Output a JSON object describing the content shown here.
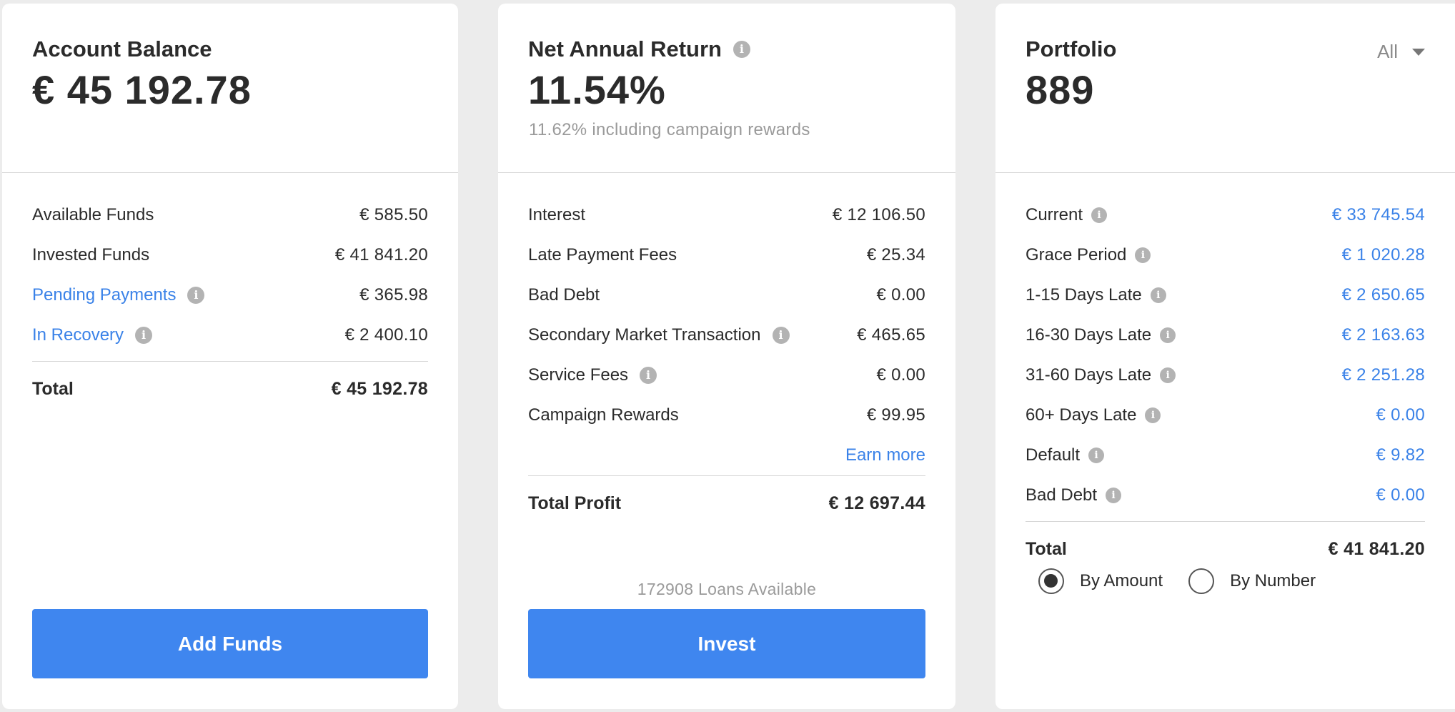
{
  "account_balance": {
    "title": "Account Balance",
    "amount": "€ 45 192.78",
    "rows": [
      {
        "label": "Available Funds",
        "value": "€ 585.50"
      },
      {
        "label": "Invested Funds",
        "value": "€ 41 841.20"
      },
      {
        "label": "Pending Payments",
        "value": "€ 365.98"
      },
      {
        "label": "In Recovery",
        "value": "€ 2 400.10"
      }
    ],
    "total_label": "Total",
    "total_value": "€ 45 192.78",
    "button_label": "Add Funds"
  },
  "net_annual_return": {
    "title": "Net Annual Return",
    "amount": "11.54%",
    "subtitle": "11.62% including campaign rewards",
    "rows": [
      {
        "label": "Interest",
        "value": "€ 12 106.50"
      },
      {
        "label": "Late Payment Fees",
        "value": "€ 25.34"
      },
      {
        "label": "Bad Debt",
        "value": "€ 0.00"
      },
      {
        "label": "Secondary Market Transaction",
        "value": "€ 465.65"
      },
      {
        "label": "Service Fees",
        "value": "€ 0.00"
      },
      {
        "label": "Campaign Rewards",
        "value": "€ 99.95"
      }
    ],
    "earn_more": "Earn more",
    "total_label": "Total Profit",
    "total_value": "€ 12 697.44",
    "loans_available": "172908 Loans Available",
    "button_label": "Invest"
  },
  "portfolio": {
    "title": "Portfolio",
    "amount": "889",
    "filter_value": "All",
    "rows": [
      {
        "label": "Current",
        "value": "€ 33 745.54"
      },
      {
        "label": "Grace Period",
        "value": "€ 1 020.28"
      },
      {
        "label": "1-15 Days Late",
        "value": "€ 2 650.65"
      },
      {
        "label": "16-30 Days Late",
        "value": "€ 2 163.63"
      },
      {
        "label": "31-60 Days Late",
        "value": "€ 2 251.28"
      },
      {
        "label": "60+ Days Late",
        "value": "€ 0.00"
      },
      {
        "label": "Default",
        "value": "€ 9.82"
      },
      {
        "label": "Bad Debt",
        "value": "€ 0.00"
      }
    ],
    "total_label": "Total",
    "total_value": "€ 41 841.20",
    "radio_by_amount": "By Amount",
    "radio_by_number": "By Number",
    "selected_radio": "By Amount"
  },
  "info_glyph": "i",
  "colors": {
    "accent": "#3f86ef",
    "link": "#3a82e8",
    "background": "#ececec",
    "card": "#ffffff",
    "muted": "#9a9a9a"
  },
  "icons": {
    "info": "info-icon",
    "dropdown": "chevron-down-icon"
  }
}
